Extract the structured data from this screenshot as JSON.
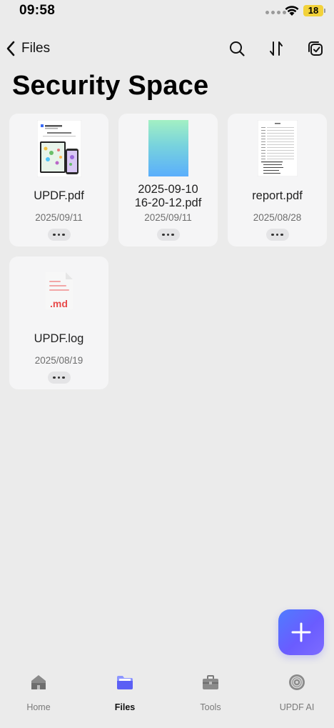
{
  "status_bar": {
    "time": "09:58",
    "battery": "18"
  },
  "nav": {
    "back_label": "Files",
    "icons": [
      "search-icon",
      "sort-icon",
      "select-icon"
    ]
  },
  "page_title": "Security Space",
  "files": [
    {
      "name": "UPDF.pdf",
      "date": "2025/09/11",
      "thumb": "updf-doc-preview"
    },
    {
      "name": "2025-09-10\n16-20-12.pdf",
      "date": "2025/09/11",
      "thumb": "gradient-preview"
    },
    {
      "name": "report.pdf",
      "date": "2025/08/28",
      "thumb": "report-doc-preview"
    },
    {
      "name": "UPDF.log",
      "date": "2025/08/19",
      "thumb": "md-file-icon",
      "thumb_label": ".md"
    }
  ],
  "fab": {
    "icon": "plus-icon"
  },
  "tabs": [
    {
      "label": "Home",
      "icon": "home-icon",
      "active": false
    },
    {
      "label": "Files",
      "icon": "folder-icon",
      "active": true
    },
    {
      "label": "Tools",
      "icon": "toolbox-icon",
      "active": false
    },
    {
      "label": "UPDF AI",
      "icon": "ai-icon",
      "active": false
    }
  ],
  "colors": {
    "accent": "#5b6cff",
    "background": "#ebebeb",
    "card": "#f5f5f6"
  }
}
